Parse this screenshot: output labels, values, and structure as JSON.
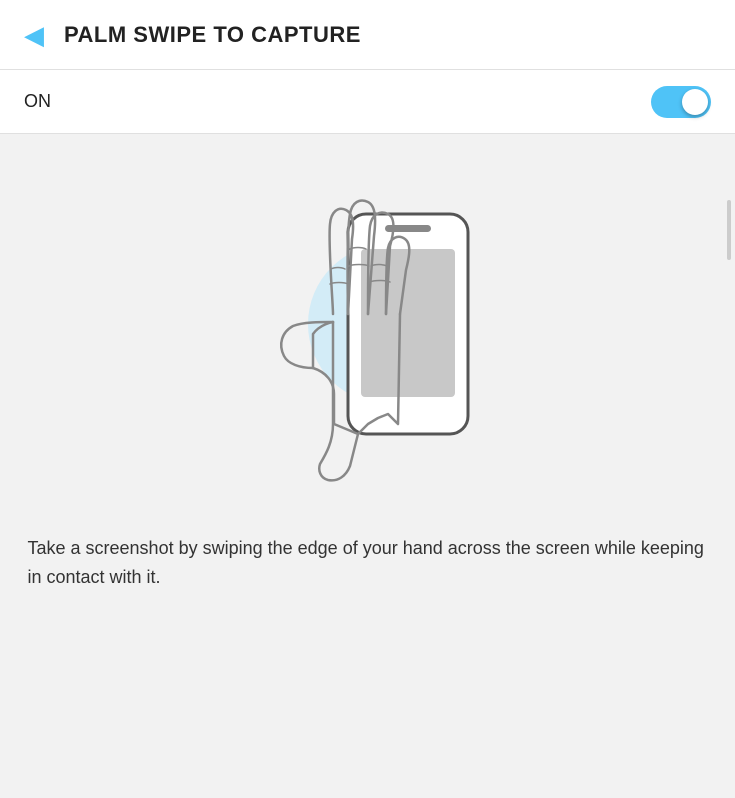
{
  "header": {
    "back_icon": "◀",
    "title": "PALM SWIPE TO CAPTURE"
  },
  "toggle": {
    "label": "ON",
    "state": true
  },
  "description": {
    "text": "Take a screenshot by swiping the edge of your hand across the screen while keeping in contact with it."
  },
  "colors": {
    "accent": "#4fc3f7",
    "blue_circle": "rgba(179,229,252,0.5)",
    "hand_stroke": "#888888",
    "phone_stroke": "#555555",
    "phone_screen": "#c8c8c8",
    "bg": "#f2f2f2"
  }
}
